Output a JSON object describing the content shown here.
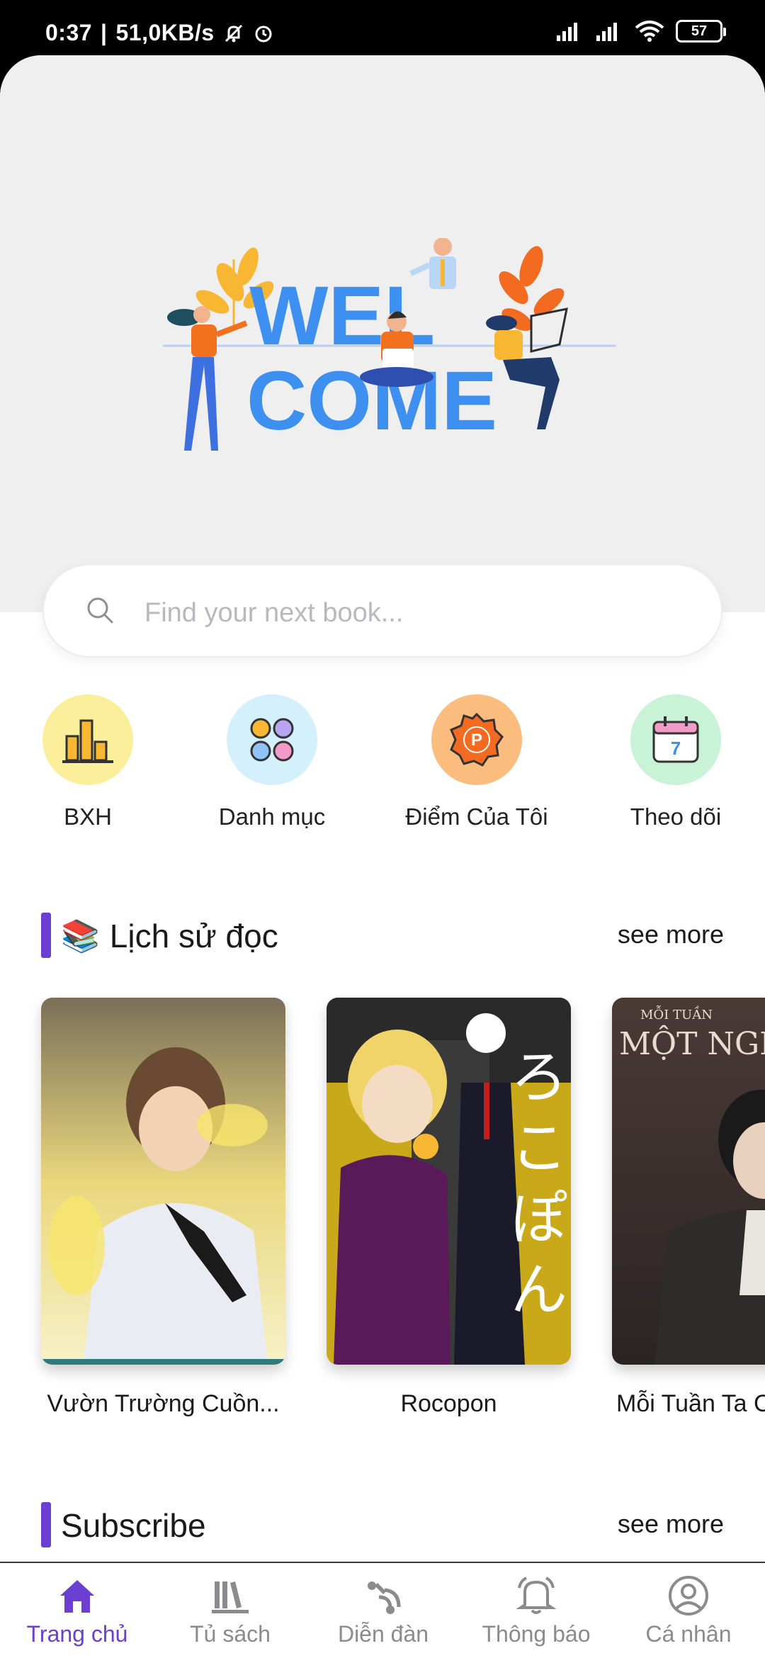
{
  "status_bar": {
    "time": "0:37",
    "network_speed": "51,0KB/s",
    "battery": "57"
  },
  "hero": {
    "welcome_line1": "WEL",
    "welcome_line2": "COME"
  },
  "search": {
    "placeholder": "Find your next book..."
  },
  "quick_actions": [
    {
      "label": "BXH",
      "icon": "bar-chart-icon",
      "bg": "#fcef9c"
    },
    {
      "label": "Danh mục",
      "icon": "category-grid-icon",
      "bg": "#d4f0fc"
    },
    {
      "label": "Điểm Của Tôi",
      "icon": "points-badge-icon",
      "bg": "#fbbd7d"
    },
    {
      "label": "Theo dõi",
      "icon": "calendar-icon",
      "bg": "#c8f3d6"
    }
  ],
  "history": {
    "title": "Lịch sử đọc",
    "emoji": "📚",
    "see_more": "see more",
    "books": [
      {
        "title": "Vườn Trường Cuồn..."
      },
      {
        "title": "Rocopon"
      },
      {
        "title": "Mỗi Tuần Ta C"
      }
    ]
  },
  "subscribe": {
    "title": "Subscribe",
    "see_more": "see more"
  },
  "bottom_nav": [
    {
      "label": "Trang chủ",
      "icon": "home-icon",
      "active": true
    },
    {
      "label": "Tủ sách",
      "icon": "bookshelf-icon",
      "active": false
    },
    {
      "label": "Diễn đàn",
      "icon": "forum-icon",
      "active": false
    },
    {
      "label": "Thông báo",
      "icon": "bell-icon",
      "active": false
    },
    {
      "label": "Cá nhân",
      "icon": "profile-icon",
      "active": false
    }
  ],
  "colors": {
    "accent": "#6b3fd1",
    "hero_bg": "#efeff0",
    "welcome_blue": "#3d8ff0"
  }
}
